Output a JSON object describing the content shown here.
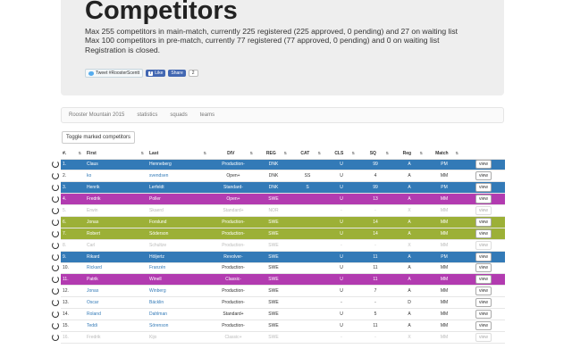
{
  "header": {
    "title": "Competitors",
    "line1": "Max 255 competitors in main-match, currently 225 registered (225 approved, 0 pending) and 27 on waiting list",
    "line2": "Max 100 competitors in pre-match, currently 77 registered (77 approved, 0 pending) and 0 on waiting list",
    "line3": "Registration is closed.",
    "tweet_label": "Tweet #RoosterScentt",
    "fb_like_label": "Like",
    "fb_share_label": "Share",
    "fb_count": "2"
  },
  "nav": {
    "items": [
      "Rooster Mountain 2015",
      "statistics",
      "squads",
      "teams"
    ]
  },
  "toggle_button": "Toggle marked competitors",
  "table": {
    "headers": [
      "#.",
      "First",
      "Last",
      "DIV",
      "REG",
      "CAT",
      "CLS",
      "SQ",
      "Reg",
      "Match"
    ],
    "view_label": "view",
    "rows": [
      {
        "style": "blue",
        "num": "1.",
        "first": "Claus",
        "last": "Henneberg",
        "div": "Production-",
        "reg": "DNK",
        "cat": "",
        "cls": "U",
        "sq": "99",
        "r": "A",
        "match": "PM"
      },
      {
        "style": "normal",
        "num": "2.",
        "first": "ko",
        "last": "svendsen",
        "div": "Open+",
        "reg": "DNK",
        "cat": "SS",
        "cls": "U",
        "sq": "4",
        "r": "A",
        "match": "MM"
      },
      {
        "style": "blue",
        "num": "3.",
        "first": "Henrik",
        "last": "Lerfeldt",
        "div": "Standard-",
        "reg": "DNK",
        "cat": "S",
        "cls": "U",
        "sq": "99",
        "r": "A",
        "match": "PM"
      },
      {
        "style": "purple",
        "num": "4.",
        "first": "Fredrik",
        "last": "Poller",
        "div": "Open+",
        "reg": "SWE",
        "cat": "",
        "cls": "U",
        "sq": "13",
        "r": "A",
        "match": "MM"
      },
      {
        "style": "gray",
        "num": "5.",
        "first": "Erwin",
        "last": "Skaerd",
        "div": "Standard+",
        "reg": "NOR",
        "cat": "",
        "cls": "-",
        "sq": "-",
        "r": "X",
        "match": "MM"
      },
      {
        "style": "olive",
        "num": "6.",
        "first": "Jonas",
        "last": "Forslund",
        "div": "Production-",
        "reg": "SWE",
        "cat": "",
        "cls": "U",
        "sq": "14",
        "r": "A",
        "match": "MM"
      },
      {
        "style": "olive",
        "num": "7.",
        "first": "Robert",
        "last": "Söderson",
        "div": "Production-",
        "reg": "SWE",
        "cat": "",
        "cls": "U",
        "sq": "14",
        "r": "A",
        "match": "MM"
      },
      {
        "style": "gray",
        "num": "8.",
        "first": "Carl",
        "last": "Schultze",
        "div": "Production-",
        "reg": "SWE",
        "cat": "",
        "cls": "-",
        "sq": "-",
        "r": "X",
        "match": "MM"
      },
      {
        "style": "blue",
        "num": "9.",
        "first": "Rikard",
        "last": "Höljertz",
        "div": "Revolver-",
        "reg": "SWE",
        "cat": "",
        "cls": "U",
        "sq": "11",
        "r": "A",
        "match": "PM"
      },
      {
        "style": "normal",
        "num": "10.",
        "first": "Rickard",
        "last": "Franzén",
        "div": "Production-",
        "reg": "SWE",
        "cat": "",
        "cls": "U",
        "sq": "11",
        "r": "A",
        "match": "MM"
      },
      {
        "style": "purple",
        "num": "11.",
        "first": "Patrik",
        "last": "Winell",
        "div": "Classic-",
        "reg": "SWE",
        "cat": "",
        "cls": "U",
        "sq": "11",
        "r": "A",
        "match": "MM"
      },
      {
        "style": "normal",
        "num": "12.",
        "first": "Jonas",
        "last": "Winberg",
        "div": "Production-",
        "reg": "SWE",
        "cat": "",
        "cls": "U",
        "sq": "7",
        "r": "A",
        "match": "MM"
      },
      {
        "style": "normal",
        "num": "13.",
        "first": "Oscar",
        "last": "Bäcklin",
        "div": "Production-",
        "reg": "SWE",
        "cat": "",
        "cls": "-",
        "sq": "-",
        "r": "D",
        "match": "MM"
      },
      {
        "style": "normal",
        "num": "14.",
        "first": "Roland",
        "last": "Dahlman",
        "div": "Standard+",
        "reg": "SWE",
        "cat": "",
        "cls": "U",
        "sq": "5",
        "r": "A",
        "match": "MM"
      },
      {
        "style": "normal",
        "num": "15.",
        "first": "Teddi",
        "last": "Sörenson",
        "div": "Production-",
        "reg": "SWE",
        "cat": "",
        "cls": "U",
        "sq": "11",
        "r": "A",
        "match": "MM"
      },
      {
        "style": "gray",
        "num": "16.",
        "first": "Fredrik",
        "last": "Kijo",
        "div": "Classic+",
        "reg": "SWE",
        "cat": "",
        "cls": "-",
        "sq": "-",
        "r": "X",
        "match": "MM"
      }
    ]
  }
}
